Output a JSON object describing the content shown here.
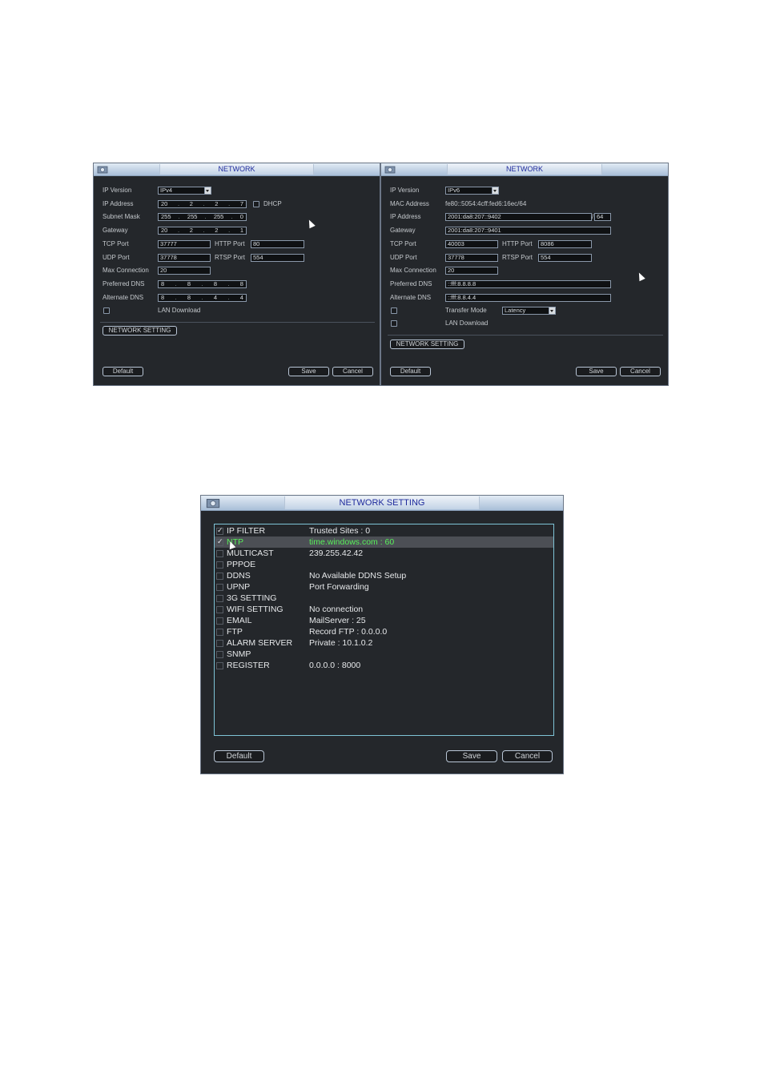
{
  "ipv4_window": {
    "title": "NETWORK",
    "labels": {
      "ip_version": "IP Version",
      "ip_address": "IP Address",
      "subnet_mask": "Subnet Mask",
      "gateway": "Gateway",
      "tcp_port": "TCP Port",
      "udp_port": "UDP Port",
      "max_connection": "Max Connection",
      "preferred_dns": "Preferred DNS",
      "alternate_dns": "Alternate DNS",
      "http_port": "HTTP Port",
      "rtsp_port": "RTSP Port",
      "dhcp": "DHCP",
      "lan_download": "LAN Download"
    },
    "values": {
      "ip_version": "IPv4",
      "ip_address": [
        "20",
        "2",
        "2",
        "7"
      ],
      "subnet_mask": [
        "255",
        "255",
        "255",
        "0"
      ],
      "gateway": [
        "20",
        "2",
        "2",
        "1"
      ],
      "tcp_port": "37777",
      "udp_port": "37778",
      "max_connection": "20",
      "preferred_dns": [
        "8",
        "8",
        "8",
        "8"
      ],
      "alternate_dns": [
        "8",
        "8",
        "4",
        "4"
      ],
      "http_port": "80",
      "rtsp_port": "554"
    },
    "network_setting_button": "NETWORK SETTING",
    "default_button": "Default",
    "save_button": "Save",
    "cancel_button": "Cancel"
  },
  "ipv6_window": {
    "title": "NETWORK",
    "labels": {
      "ip_version": "IP Version",
      "mac_address": "MAC Address",
      "ip_address": "IP Address",
      "gateway": "Gateway",
      "tcp_port": "TCP Port",
      "udp_port": "UDP Port",
      "max_connection": "Max Connection",
      "preferred_dns": "Preferred DNS",
      "alternate_dns": "Alternate DNS",
      "http_port": "HTTP Port",
      "rtsp_port": "RTSP Port",
      "transfer_mode": "Transfer Mode",
      "lan_download": "LAN Download"
    },
    "values": {
      "ip_version": "IPv6",
      "mac_address": "fe80::5054:4cff:fed6:16ec/64",
      "ip_address": "2001:da8:207::9402",
      "prefix": "64",
      "prefix_slash": "/",
      "gateway": "2001:da8:207::9401",
      "tcp_port": "40003",
      "udp_port": "37778",
      "max_connection": "20",
      "preferred_dns": "::fff:8.8.8.8",
      "alternate_dns": "::fff:8.8.4.4",
      "http_port": "8086",
      "rtsp_port": "554",
      "transfer_mode": "Latency"
    },
    "network_setting_button": "NETWORK SETTING",
    "default_button": "Default",
    "save_button": "Save",
    "cancel_button": "Cancel"
  },
  "network_setting_window": {
    "title": "NETWORK SETTING",
    "items": [
      {
        "name": "IP FILTER",
        "value": "Trusted Sites : 0",
        "checked": true
      },
      {
        "name": "NTP",
        "value": "time.windows.com : 60",
        "checked": true
      },
      {
        "name": "MULTICAST",
        "value": "239.255.42.42",
        "checked": false
      },
      {
        "name": "PPPOE",
        "value": "",
        "checked": false
      },
      {
        "name": "DDNS",
        "value": "No Available DDNS Setup",
        "checked": false
      },
      {
        "name": "UPNP",
        "value": "Port Forwarding",
        "checked": false
      },
      {
        "name": "3G SETTING",
        "value": "",
        "checked": false
      },
      {
        "name": "WIFI SETTING",
        "value": "No connection",
        "checked": false
      },
      {
        "name": "EMAIL",
        "value": "MailServer : 25",
        "checked": false
      },
      {
        "name": "FTP",
        "value": "Record FTP : 0.0.0.0",
        "checked": false
      },
      {
        "name": "ALARM SERVER",
        "value": "Private : 10.1.0.2",
        "checked": false
      },
      {
        "name": "SNMP",
        "value": "",
        "checked": false
      },
      {
        "name": "REGISTER",
        "value": "0.0.0.0 : 8000",
        "checked": false
      }
    ],
    "default_button": "Default",
    "save_button": "Save",
    "cancel_button": "Cancel"
  }
}
